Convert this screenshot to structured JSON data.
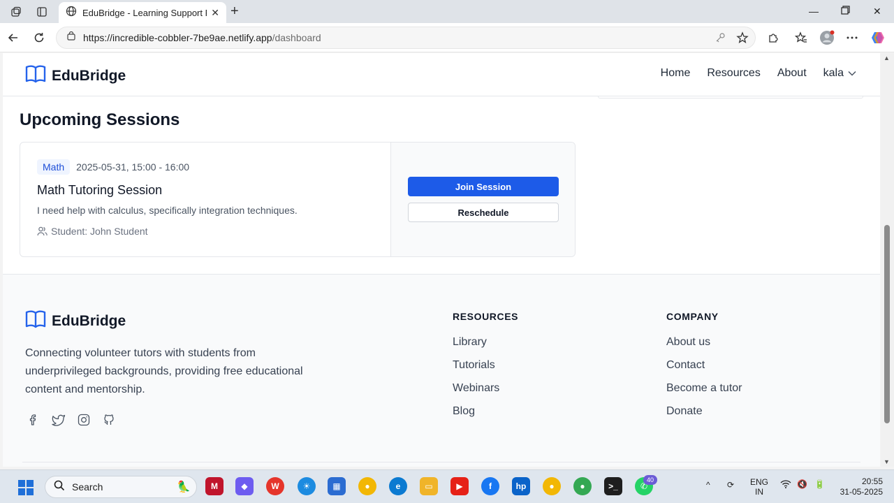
{
  "browser": {
    "tab_title": "EduBridge - Learning Support Pla",
    "url_host": "https://incredible-cobbler-7be9ae.netlify.app",
    "url_path": "/dashboard"
  },
  "site": {
    "brand": "EduBridge",
    "nav": [
      "Home",
      "Resources",
      "About"
    ],
    "user": "kala"
  },
  "sessions": {
    "heading": "Upcoming Sessions",
    "items": [
      {
        "subject": "Math",
        "datetime": "2025-05-31, 15:00 - 16:00",
        "title": "Math Tutoring Session",
        "description": "I need help with calculus, specifically integration techniques.",
        "student": "Student: John Student",
        "primary_action": "Join Session",
        "secondary_action": "Reschedule"
      }
    ]
  },
  "footer": {
    "brand": "EduBridge",
    "description": "Connecting volunteer tutors with students from underprivileged backgrounds, providing free educational content and mentorship.",
    "resources_heading": "RESOURCES",
    "resources_links": [
      "Library",
      "Tutorials",
      "Webinars",
      "Blog"
    ],
    "company_heading": "COMPANY",
    "company_links": [
      "About us",
      "Contact",
      "Become a tutor",
      "Donate"
    ]
  },
  "taskbar": {
    "search_label": "Search",
    "lang_top": "ENG",
    "lang_bottom": "IN",
    "time": "20:55",
    "date": "31-05-2025",
    "whatsapp_badge": "40"
  },
  "colors": {
    "primary": "#1d5be8",
    "brand_icon": "#2563eb",
    "badge_bg": "#eff4ff",
    "badge_text": "#1d4ed8"
  }
}
